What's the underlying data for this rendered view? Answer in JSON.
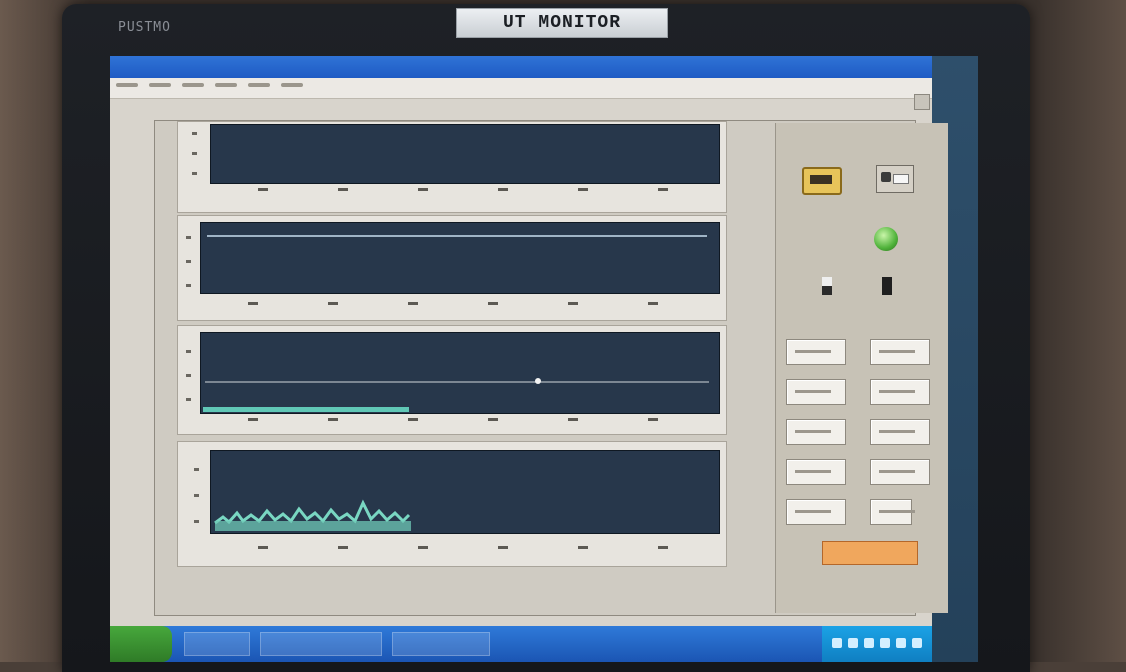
{
  "monitor": {
    "brand": "PUSTMO",
    "label": "UT MONITOR"
  },
  "window": {
    "icons": {
      "open": "folder-icon",
      "capture": "camera-icon",
      "status": "led-icon"
    },
    "stop_button": ""
  },
  "colors": {
    "plot_bg": "#27374b",
    "led_green": "#4fb23a",
    "stop_orange": "#f0a75d",
    "taskbar_blue": "#1f5bc4"
  }
}
